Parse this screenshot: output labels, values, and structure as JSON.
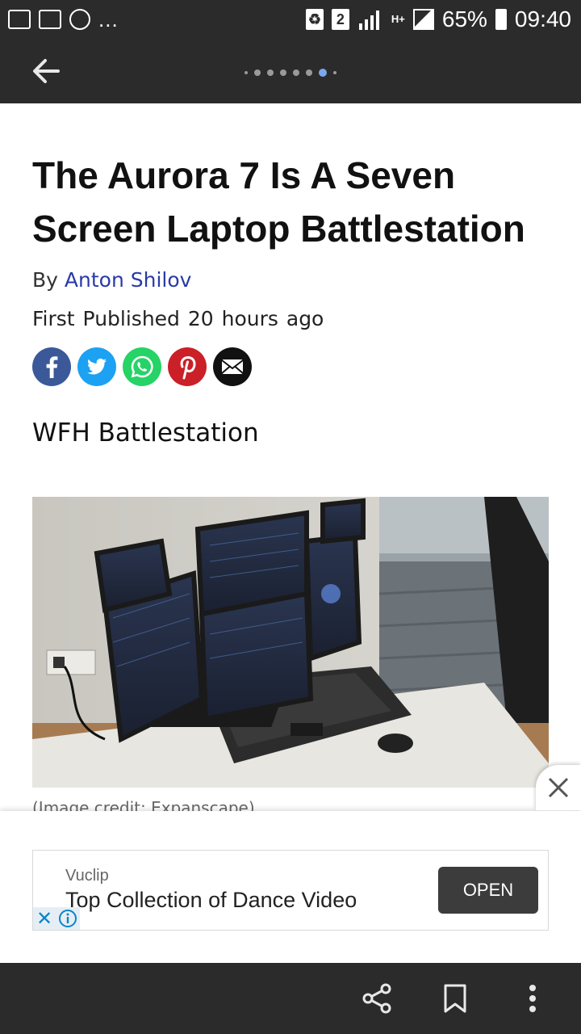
{
  "status_bar": {
    "sim_badge": "2",
    "network": "H+",
    "battery_percent": "65%",
    "time": "09:40",
    "overflow": "..."
  },
  "app_bar": {
    "back_icon": "arrow-left-icon",
    "page_indicator": {
      "total_dots": 8,
      "active_index": 6
    }
  },
  "article": {
    "title": "The Aurora 7 Is A Seven Screen Laptop Battlestation",
    "byline_prefix": "By",
    "author": "Anton Shilov",
    "published_label": "First Published",
    "published_time": "20 hours ago",
    "share_icons": [
      "facebook-icon",
      "twitter-icon",
      "whatsapp-icon",
      "pinterest-icon",
      "email-icon"
    ],
    "subheading": "WFH Battlestation",
    "image_credit": "(Image credit: Expanscape)"
  },
  "ad": {
    "advertiser": "Vuclip",
    "headline": "Top Collection of Dance Video",
    "cta": "OPEN"
  },
  "bottom_bar": {
    "icons": [
      "share-icon",
      "bookmark-icon",
      "more-vert-icon"
    ]
  },
  "colors": {
    "bar_bg": "#2b2b2b",
    "author_link": "#2a3aa8",
    "active_dot": "#7aa7f0",
    "facebook": "#3b5998",
    "twitter": "#1da1f2",
    "whatsapp": "#25d366",
    "pinterest": "#cb2027",
    "email": "#111111"
  }
}
